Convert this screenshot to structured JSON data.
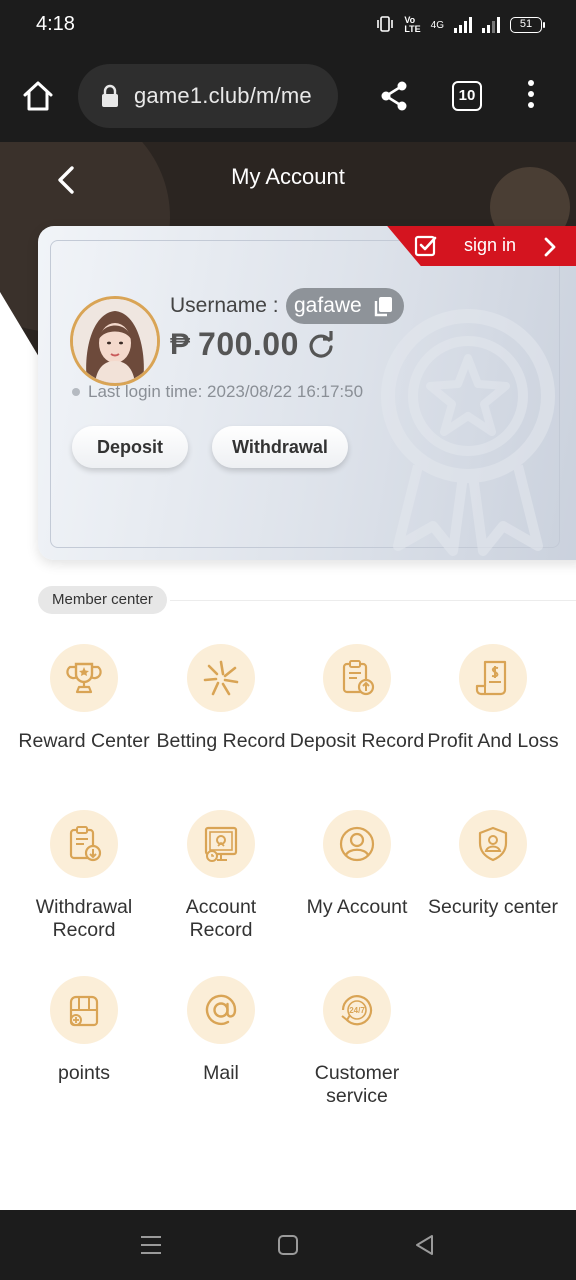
{
  "status_bar": {
    "time": "4:18",
    "network": "4G",
    "battery": "51"
  },
  "browser": {
    "url": "game1.club/m/me",
    "tab_count": "10"
  },
  "header": {
    "title": "My Account"
  },
  "card": {
    "sign_in_label": "sign in",
    "username_label": "Username :",
    "username": "gafawe",
    "currency_symbol": "₱",
    "balance": "700.00",
    "last_login": "Last login time: 2023/08/22 16:17:50",
    "deposit_label": "Deposit",
    "withdrawal_label": "Withdrawal"
  },
  "member_center": {
    "title": "Member center",
    "items": [
      {
        "label": "Reward Center",
        "icon": "trophy-icon"
      },
      {
        "label": "Betting Record",
        "icon": "star-burst-icon"
      },
      {
        "label": "Deposit Record",
        "icon": "clipboard-upload-icon"
      },
      {
        "label": "Profit And Loss",
        "icon": "receipt-dollar-icon"
      },
      {
        "label": "Withdrawal Record",
        "icon": "clipboard-download-icon"
      },
      {
        "label": "Account Record",
        "icon": "account-record-icon"
      },
      {
        "label": "My Account",
        "icon": "user-circle-icon"
      },
      {
        "label": "Security center",
        "icon": "shield-user-icon"
      },
      {
        "label": "points",
        "icon": "gift-box-icon"
      },
      {
        "label": "Mail",
        "icon": "at-sign-icon"
      },
      {
        "label": "Customer service",
        "icon": "support-24-7-icon"
      }
    ]
  },
  "colors": {
    "accent_red": "#d4141f",
    "icon_bg": "#fbeed8",
    "icon_stroke": "#d9a455",
    "header_bg": "#2b2521"
  }
}
